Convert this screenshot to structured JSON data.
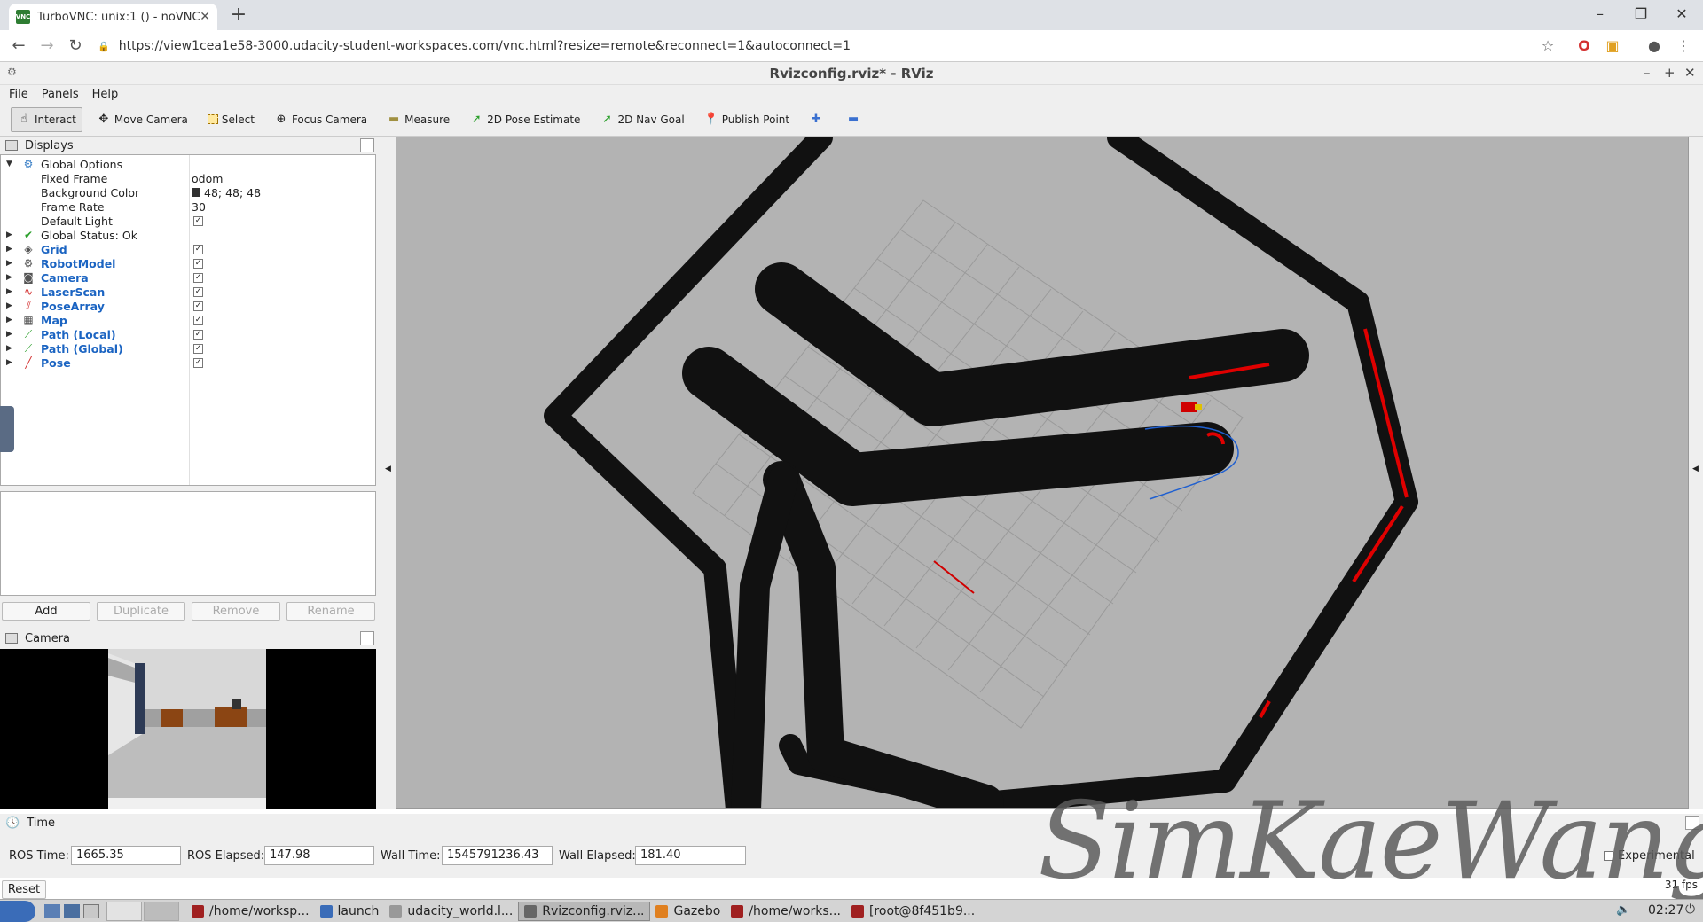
{
  "browser": {
    "tab_title": "TurboVNC: unix:1 () - noVNC",
    "url": "https://view1cea1e58-3000.udacity-student-workspaces.com/vnc.html?resize=remote&reconnect=1&autoconnect=1"
  },
  "window_title": "Rvizconfig.rviz* - RViz",
  "menu": [
    "File",
    "Panels",
    "Help"
  ],
  "toolbar": {
    "interact": "Interact",
    "move_camera": "Move Camera",
    "select": "Select",
    "focus_camera": "Focus Camera",
    "measure": "Measure",
    "pose_estimate": "2D Pose Estimate",
    "nav_goal": "2D Nav Goal",
    "publish_point": "Publish Point"
  },
  "displays": {
    "title": "Displays",
    "global_options": "Global Options",
    "fixed_frame_label": "Fixed Frame",
    "fixed_frame_value": "odom",
    "bg_color_label": "Background Color",
    "bg_color_value": "48; 48; 48",
    "frame_rate_label": "Frame Rate",
    "frame_rate_value": "30",
    "default_light_label": "Default Light",
    "global_status": "Global Status: Ok",
    "items": [
      "Grid",
      "RobotModel",
      "Camera",
      "LaserScan",
      "PoseArray",
      "Map",
      "Path (Local)",
      "Path (Global)",
      "Pose"
    ]
  },
  "buttons": {
    "add": "Add",
    "duplicate": "Duplicate",
    "remove": "Remove",
    "rename": "Rename"
  },
  "camera_panel": "Camera",
  "time": {
    "title": "Time",
    "ros_time_label": "ROS Time:",
    "ros_time": "1665.35",
    "ros_elapsed_label": "ROS Elapsed:",
    "ros_elapsed": "147.98",
    "wall_time_label": "Wall Time:",
    "wall_time": "1545791236.43",
    "wall_elapsed_label": "Wall Elapsed:",
    "wall_elapsed": "181.40",
    "experimental": "Experimental",
    "reset": "Reset",
    "fps": "31 fps"
  },
  "taskbar": {
    "items": [
      "/home/worksp...",
      "launch",
      "udacity_world.l...",
      "Rvizconfig.rviz...",
      "Gazebo",
      "/home/works...",
      "[root@8f451b9..."
    ],
    "clock": "02:27"
  },
  "watermark": "SimKaeWang"
}
